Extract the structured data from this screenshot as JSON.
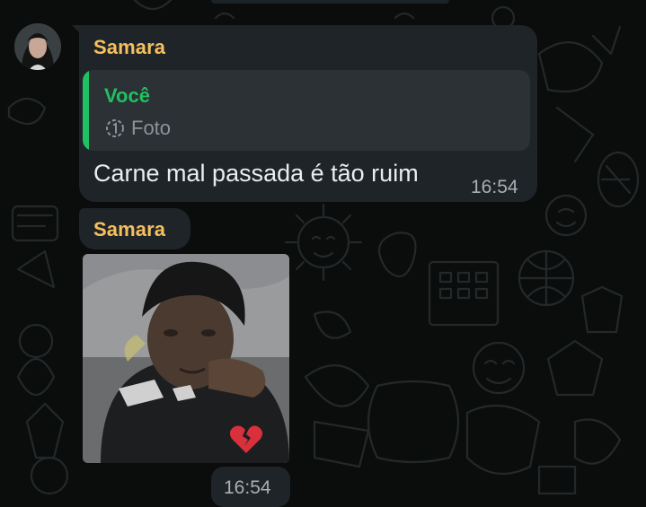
{
  "messages": [
    {
      "sender": "Samara",
      "quoted": {
        "author": "Você",
        "preview": "Foto",
        "preview_icon": "view-once-photo-icon"
      },
      "text": "Carne mal passada é tão ruim",
      "time": "16:54"
    },
    {
      "sender": "Samara",
      "attachment": {
        "type": "photo",
        "overlay_icon": "broken-heart-icon"
      },
      "time": "16:54"
    }
  ],
  "colors": {
    "background": "#0b0d0d",
    "bubble": "#1f2428",
    "quote_background": "#2b3134",
    "sender_name": "#f6c05e",
    "quote_accent": "#21c063",
    "message_text": "#e9edef",
    "timestamp": "#a8b0b4"
  }
}
